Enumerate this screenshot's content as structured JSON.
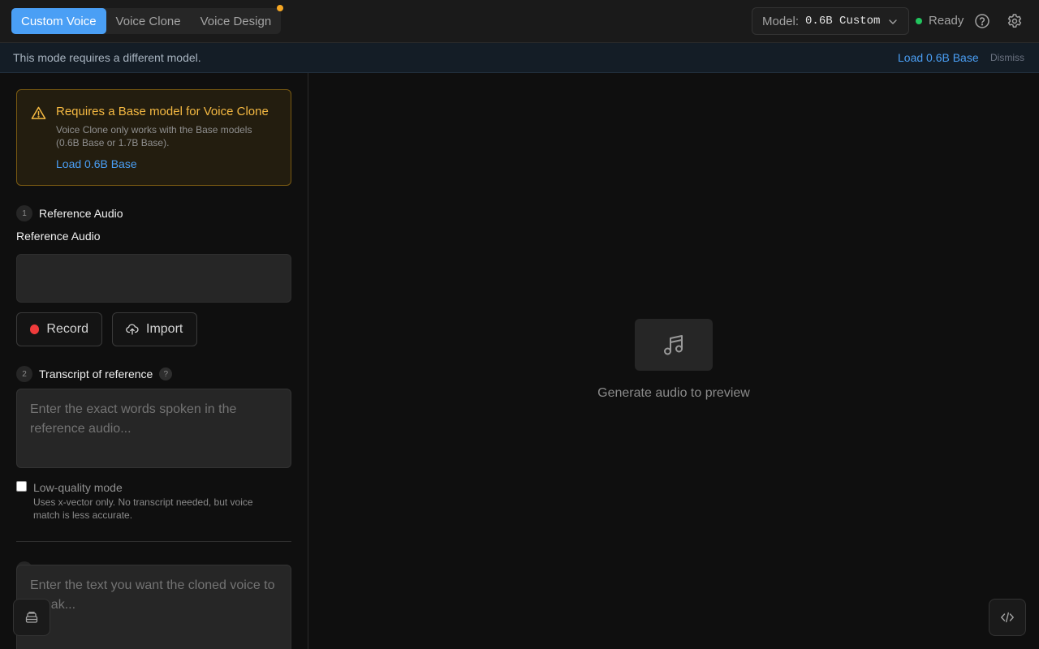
{
  "header": {
    "tabs": [
      {
        "label": "Custom Voice",
        "active": true
      },
      {
        "label": "Voice Clone",
        "active": false
      },
      {
        "label": "Voice Design",
        "active": false
      }
    ],
    "model_label": "Model:",
    "model_value": "0.6B Custom",
    "status_text": "Ready",
    "status_color": "#22c55e",
    "icons": [
      "chevron-down-icon",
      "help-icon",
      "gear-icon"
    ]
  },
  "notice": {
    "text": "This mode requires a different model.",
    "load_label": "Load 0.6B Base",
    "dismiss_label": "Dismiss"
  },
  "warning": {
    "title": "Requires a Base model for Voice Clone",
    "description": "Voice Clone only works with the Base models (0.6B Base or 1.7B Base).",
    "link_label": "Load 0.6B Base",
    "icon": "warning-triangle-icon"
  },
  "reference": {
    "step_number": "1",
    "step_title": "Reference Audio",
    "field_label": "Reference Audio",
    "record_label": "Record",
    "import_label": "Import"
  },
  "transcript": {
    "step_number": "2",
    "step_title": "Transcript of reference",
    "help_badge": "?",
    "placeholder": "Enter the exact words spoken in the reference audio...",
    "low_quality_label": "Low-quality mode",
    "low_quality_desc": "Uses x-vector only. No transcript needed, but voice match is less accurate.",
    "low_quality_checked": false
  },
  "target": {
    "placeholder": "Enter the text you want the cloned voice to speak..."
  },
  "preview": {
    "icon": "music-note-icon",
    "text": "Generate audio to preview"
  },
  "floating": {
    "left_icon": "stack-icon",
    "right_icon": "code-icon"
  },
  "colors": {
    "accent": "#4a9ff5",
    "warning": "#f5b942",
    "record": "#ef3b3b",
    "tab_dot": "#f5a623"
  }
}
